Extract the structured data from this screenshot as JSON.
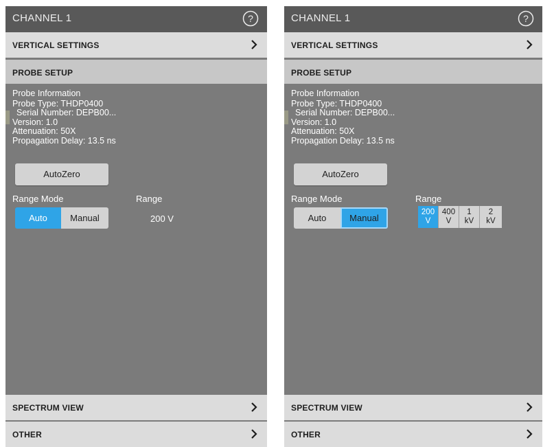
{
  "panels": [
    {
      "title": "CHANNEL 1",
      "sections": {
        "vertical": "VERTICAL SETTINGS",
        "probe": "PROBE SETUP",
        "spectrum": "SPECTRUM VIEW",
        "other": "OTHER"
      },
      "probe_info": {
        "heading": "Probe Information",
        "type": "Probe Type: THDP0400",
        "serial": "Serial Number: DEPB00...",
        "version": "Version: 1.0",
        "attenuation": "Attenuation: 50X",
        "delay": "Propagation Delay: 13.5 ns"
      },
      "autozero_label": "AutoZero",
      "range_mode_label": "Range Mode",
      "range_label": "Range",
      "mode_options": [
        "Auto",
        "Manual"
      ],
      "selected_mode": "Auto",
      "range_value": "200 V"
    },
    {
      "title": "CHANNEL 1",
      "sections": {
        "vertical": "VERTICAL SETTINGS",
        "probe": "PROBE SETUP",
        "spectrum": "SPECTRUM VIEW",
        "other": "OTHER"
      },
      "probe_info": {
        "heading": "Probe Information",
        "type": "Probe Type: THDP0400",
        "serial": "Serial Number: DEPB00...",
        "version": "Version: 1.0",
        "attenuation": "Attenuation: 50X",
        "delay": "Propagation Delay: 13.5 ns"
      },
      "autozero_label": "AutoZero",
      "range_mode_label": "Range Mode",
      "range_label": "Range",
      "mode_options": [
        "Auto",
        "Manual"
      ],
      "selected_mode": "Manual",
      "range_options": [
        {
          "line1": "200",
          "line2": "V"
        },
        {
          "line1": "400",
          "line2": "V"
        },
        {
          "line1": "1",
          "line2": "kV"
        },
        {
          "line1": "2",
          "line2": "kV"
        }
      ],
      "selected_range": "200 V"
    }
  ],
  "colors": {
    "panel_bg": "#7b7b7b",
    "title_bg": "#595959",
    "section_bg": "#dcdcdc",
    "accent": "#2fa4e7"
  },
  "icons": [
    "help-circle-icon",
    "chevron-right-icon"
  ]
}
